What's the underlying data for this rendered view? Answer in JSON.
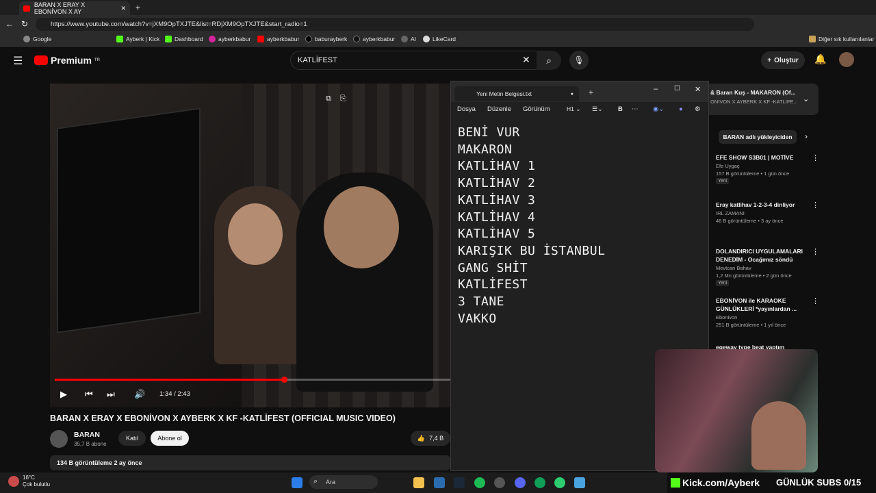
{
  "browser": {
    "tab_title": "BARAN X ERAY X EBONİVON X AY",
    "url": "https://www.youtube.com/watch?v=jXM9OpTXJTE&list=RDjXM9OpTXJTE&start_radio=1",
    "bookmarks": [
      "Google",
      "Ayberk | Kick",
      "Dashboard",
      "ayberkbabur",
      "ayberkbabur",
      "baburayberk",
      "ayberkbabur",
      "AI",
      "LikeCard"
    ],
    "other_bookmarks": "Diğer sık kullanılanlar"
  },
  "youtube": {
    "logo": "Premium",
    "logo_badge": "TR",
    "search_value": "KATLİFEST",
    "create_label": "Oluştur",
    "player": {
      "time": "1:34 / 2:43",
      "progress": 0.58
    },
    "video_title": "BARAN X ERAY X EBONİVON X AYBERK X KF -KATLİFEST (OFFICIAL MUSIC VIDEO)",
    "channel": {
      "name": "BARAN",
      "subs": "35,7 B abone",
      "join_label": "Katıl",
      "subscribe_label": "Abone ol"
    },
    "likes": "7,4 B",
    "desc_meta": "134 B görüntüleme  2 ay önce",
    "playlist": {
      "title": "& Baran Kuş - MAKARON (Of...",
      "subtitle": "ONİVON X AYBERK X KF -KATLİFE..."
    },
    "chip": "BARAN adlı yükleyiciden",
    "recommendations": [
      {
        "title": "EFE SHOW S3B01 | MOTİVE",
        "channel": "Efe Uygaç",
        "meta": "157 B görüntüleme • 1 gün önce",
        "badge": "Yeni"
      },
      {
        "title": "Eray katlihav 1-2-3-4 dinliyor",
        "channel": "IRL ZAMANI",
        "meta": "46 B görüntüleme • 3 ay önce",
        "badge": ""
      },
      {
        "title": "DOLANDIRICI UYGULAMALARI DENEDİM - Ocağımız söndü",
        "channel": "Mevtcan Bahav",
        "meta": "1,2 Mn görüntüleme • 2 gün önce",
        "badge": "Yeni"
      },
      {
        "title": "EBONİVON ile KARAOKE GÜNLÜKLERİ *yayınlardan ...",
        "channel": "Ebonivon",
        "meta": "251 B görüntüleme • 1 yıl önce",
        "badge": ""
      },
      {
        "title": "egeway type beat yaptım",
        "channel": "",
        "meta": "",
        "badge": ""
      }
    ]
  },
  "notepad": {
    "tab_title": "Yeni Metin Belgesi.txt",
    "menu": [
      "Dosya",
      "Düzenle",
      "Görünüm"
    ],
    "heading_label": "H1",
    "bold_label": "B",
    "lines": [
      "BENİ VUR",
      "MAKARON",
      "KATLİHAV 1",
      "KATLİHAV 2",
      "KATLİHAV 3",
      "KATLİHAV 4",
      "KATLİHAV 5",
      "KARIŞIK BU İSTANBUL",
      "GANG SHİT",
      "KATLİFEST",
      "3 TANE",
      "VAKKO"
    ]
  },
  "overlay": {
    "kick": "Kick.com/Ayberk",
    "subs_goal": "GÜNLÜK SUBS 0/15"
  },
  "taskbar": {
    "temp": "16°C",
    "weather": "Çok bulutlu",
    "search": "Ara"
  }
}
